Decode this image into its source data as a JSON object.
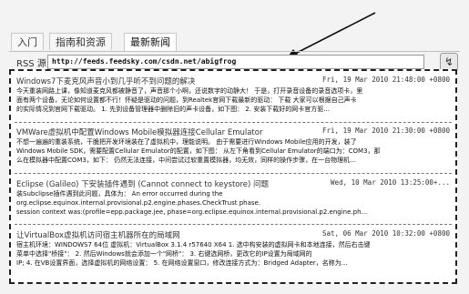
{
  "tabs": [
    "入门",
    "指南和资源",
    "最新新闻"
  ],
  "rss": {
    "label": "RSS 源:",
    "url": "http://feeds.feedsky.com/csdn.net/abigfrog",
    "refresh_icon": "refresh-icon"
  },
  "feed": [
    {
      "title": "Windows7下麦克风声音小到几乎听不到问题的解决",
      "date": "Fri, 19 Mar 2010 21:48:00 +0800",
      "lines": [
        "今天重装网路上课，像知道麦克风都被静音了，声音那个小啊，还说数字的动静大！  于是，打开录音设备的录音选项卡，里",
        "面有两个设备，无论如何设置都不行！怀疑是驱动的问题，到Realtek官网下载最新的驱动：  下载  大家可以根据自己声卡",
        "的实际情况到官网下载驱动。 1. 先到设备管理器中删除旧的声卡设备，如下图：     2. 安装下载好的网卡官方驱..."
      ]
    },
    {
      "title": "VMWare虚拟机中配置Windows Mobile模拟器连接Cellular Emulator",
      "date": "Fri, 19 Mar 2010 21:30:00 +0800",
      "lines": [
        "不想一遍遍的重装系统，干脆把开发环境装在了虚拟机中，理能说明。  由于需要进行Windows Mobile应用的开发，装了",
        "Windows Mobile SDK，需要配置Cellular Emulator的配置，如下图：     从左下角看到Cellular Emulator的端口为：COM3，那",
        "么在模拟器中配置COM3，如下：     仍然无法连接，中间尝试过软重置模拟器，均无效，同样的操作步骤，在一台物理机..."
      ]
    },
    {
      "title": "Eclipse (Galileo) 下安装插件遇到 (Cannot connect to keystore) 问题",
      "date": "Wed, 10 Mar 2010 13:25:00+...",
      "lines": [
        "装Subclipse插件遇到此问题，具体为：      An error occurred during the",
        "org.eclipse.equinox.internal.provisional.p2.engine.phases.CheckTrust phase.",
        "  session context was:(profile=epp.package.jee, phase=org.eclipse.equinox.internal.provisional.p2.engine.ph..."
      ]
    },
    {
      "title": "让VirtualBox虚拟机访问宿主机器所在的局域网",
      "date": "Sat, 06 Mar 2010 10:32:00 +0800",
      "lines": [
        "宿主机环境：WINDOWS7 64位  虚拟机：VirtualBox 3.1.4 r57640 X64  1. 选中构安装的虚拟网卡和本地连接，然后右击键",
        "菜单中选择\"桥接\"：   2. 然后Windows就会添加一个\"网桥\"：  3. 右键选网桥，更改它的IP设置为局域网的",
        "IP;   4. 在VB设置界面，选择虚拟机的网络设置：   5. 在网络设置窗口，修改连接方式为：Bridged Adapter，名称为..."
      ]
    }
  ]
}
